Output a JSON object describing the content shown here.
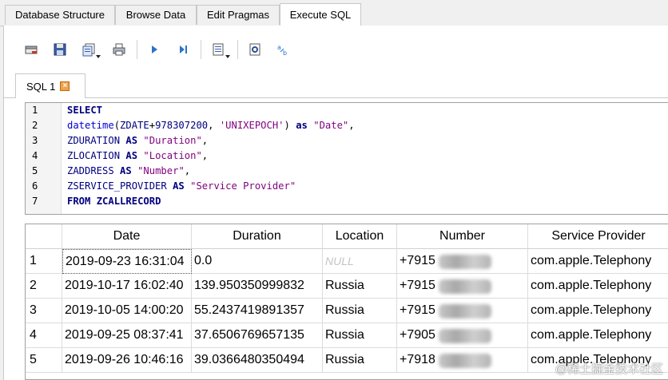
{
  "main_tabs": [
    {
      "label": "Database Structure",
      "active": false
    },
    {
      "label": "Browse Data",
      "active": false
    },
    {
      "label": "Edit Pragmas",
      "active": false
    },
    {
      "label": "Execute SQL",
      "active": true
    }
  ],
  "toolbar": {
    "icons": [
      "open-tab-icon",
      "open-sql-file-icon",
      "save-sql-file-icon",
      "print-icon",
      "execute-all-icon",
      "execute-line-icon",
      "save-results-icon",
      "find-icon",
      "find-replace-icon"
    ]
  },
  "sql_tab": {
    "label": "SQL 1",
    "close_glyph": "×"
  },
  "editor": {
    "line_numbers": [
      "1",
      "2",
      "3",
      "4",
      "5",
      "6",
      "7"
    ],
    "lines": [
      [
        {
          "t": "SELECT",
          "c": "kw"
        }
      ],
      [
        {
          "t": "datetime",
          "c": "fn"
        },
        {
          "t": "(",
          "c": "op"
        },
        {
          "t": "ZDATE",
          "c": "id"
        },
        {
          "t": "+",
          "c": "op"
        },
        {
          "t": "978307200",
          "c": "id"
        },
        {
          "t": ", ",
          "c": "op"
        },
        {
          "t": "'UNIXEPOCH'",
          "c": "str"
        },
        {
          "t": ") ",
          "c": "op"
        },
        {
          "t": "as",
          "c": "kw"
        },
        {
          "t": " ",
          "c": "op"
        },
        {
          "t": "\"Date\"",
          "c": "str"
        },
        {
          "t": ",",
          "c": "op"
        }
      ],
      [
        {
          "t": "ZDURATION",
          "c": "id"
        },
        {
          "t": " ",
          "c": "op"
        },
        {
          "t": "AS",
          "c": "kw"
        },
        {
          "t": " ",
          "c": "op"
        },
        {
          "t": "\"Duration\"",
          "c": "str"
        },
        {
          "t": ",",
          "c": "op"
        }
      ],
      [
        {
          "t": "ZLOCATION",
          "c": "id"
        },
        {
          "t": " ",
          "c": "op"
        },
        {
          "t": "AS",
          "c": "kw"
        },
        {
          "t": " ",
          "c": "op"
        },
        {
          "t": "\"Location\"",
          "c": "str"
        },
        {
          "t": ",",
          "c": "op"
        }
      ],
      [
        {
          "t": "ZADDRESS",
          "c": "id"
        },
        {
          "t": " ",
          "c": "op"
        },
        {
          "t": "AS",
          "c": "kw"
        },
        {
          "t": " ",
          "c": "op"
        },
        {
          "t": "\"Number\"",
          "c": "str"
        },
        {
          "t": ",",
          "c": "op"
        }
      ],
      [
        {
          "t": "ZSERVICE_PROVIDER",
          "c": "id"
        },
        {
          "t": " ",
          "c": "op"
        },
        {
          "t": "AS",
          "c": "kw"
        },
        {
          "t": " ",
          "c": "op"
        },
        {
          "t": "\"Service Provider\"",
          "c": "str"
        }
      ],
      [
        {
          "t": "FROM",
          "c": "kw"
        },
        {
          "t": " ",
          "c": "op"
        },
        {
          "t": "ZCALLRECORD",
          "c": "kw"
        }
      ]
    ]
  },
  "results": {
    "columns": [
      "Date",
      "Duration",
      "Location",
      "Number",
      "Service Provider"
    ],
    "rows": [
      {
        "n": "1",
        "date": "2019-09-23 16:31:04",
        "duration": "0.0",
        "location": "NULL",
        "location_null": true,
        "number": "+7915",
        "provider": "com.apple.Telephony"
      },
      {
        "n": "2",
        "date": "2019-10-17 16:02:40",
        "duration": "139.950350999832",
        "location": "Russia",
        "location_null": false,
        "number": "+7915",
        "provider": "com.apple.Telephony"
      },
      {
        "n": "3",
        "date": "2019-10-05 14:00:20",
        "duration": "55.2437419891357",
        "location": "Russia",
        "location_null": false,
        "number": "+7915",
        "provider": "com.apple.Telephony"
      },
      {
        "n": "4",
        "date": "2019-09-25 08:37:41",
        "duration": "37.6506769657135",
        "location": "Russia",
        "location_null": false,
        "number": "+7905",
        "provider": "com.apple.Telephony"
      },
      {
        "n": "5",
        "date": "2019-09-26 10:46:16",
        "duration": "39.0366480350494",
        "location": "Russia",
        "location_null": false,
        "number": "+7918",
        "provider": "com.apple.Telephony"
      }
    ]
  },
  "watermark": "@稀土掘金技术社区"
}
